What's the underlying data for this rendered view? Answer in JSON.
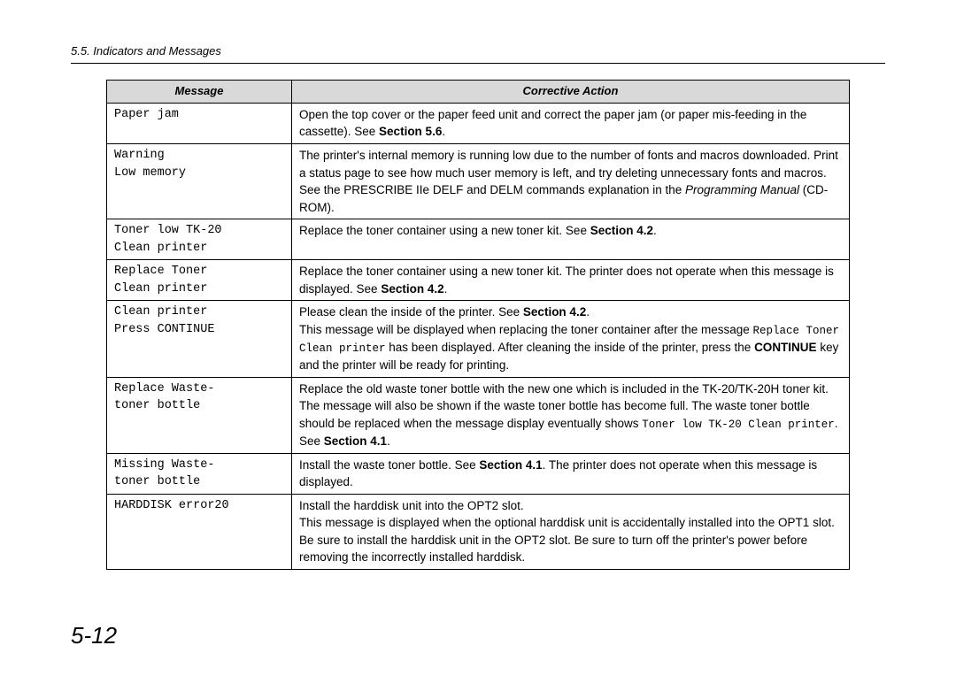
{
  "running_head": "5.5.  Indicators and Messages",
  "page_number": "5-12",
  "table": {
    "headers": {
      "col1": "Message",
      "col2": "Corrective Action"
    },
    "rows": [
      {
        "msg": "Paper jam",
        "action_pre": "Open the top cover or the paper feed unit and correct the paper jam (or paper mis-feeding in the cassette). See ",
        "action_bold": "Section 5.6",
        "action_post": "."
      },
      {
        "msg": "Warning\nLow memory",
        "action_pre": "The printer's internal memory is running low due to the number of fonts and macros downloaded. Print a status page to see how much user memory is left, and try deleting unnecessary fonts and macros. See the PRESCRIBE IIe DELF and DELM commands explanation in the ",
        "action_italic": "Programming Manual",
        "action_post": " (CD-ROM)."
      },
      {
        "msg": "Toner low TK-20\nClean printer",
        "action_pre": "Replace the toner container using a new toner kit. See ",
        "action_bold": "Section 4.2",
        "action_post": "."
      },
      {
        "msg": "Replace Toner\nClean printer",
        "action_pre": "Replace the toner container using a new toner kit. The printer does not operate when this message is displayed. See ",
        "action_bold": "Section 4.2",
        "action_post": "."
      },
      {
        "msg": "Clean printer\nPress CONTINUE",
        "a1": "Please clean the inside of the printer. See ",
        "a1_bold": "Section 4.2",
        "a1_post": ".",
        "a2_pre": "This message will be displayed when replacing the toner container after the message ",
        "a2_mono": "Replace Toner Clean printer",
        "a2_mid": " has been displayed. After cleaning the inside of the printer, press the ",
        "a2_bold": "CONTINUE",
        "a2_post": " key and the printer will be ready for printing."
      },
      {
        "msg": "Replace Waste-\ntoner bottle",
        "a_pre": "Replace the old waste toner bottle with the new one which is included in the TK-20/TK-20H toner kit. The message will also be shown if the waste toner bottle has become full. The waste toner bottle should be replaced when the message display eventually shows ",
        "a_mono": "Toner low TK-20 Clean printer",
        "a_mid": ". See ",
        "a_bold": "Section 4.1",
        "a_post": "."
      },
      {
        "msg": "Missing Waste-\ntoner bottle",
        "a_pre": "Install the waste toner bottle. See ",
        "a_bold": "Section 4.1",
        "a_post": ". The printer does not operate when this message is displayed."
      },
      {
        "msg": "HARDDISK error20",
        "a_line1": "Install the harddisk unit into the OPT2 slot.",
        "a_line2": "This message is displayed when the optional harddisk unit is accidentally installed into the OPT1 slot.  Be sure to install the harddisk unit in the OPT2 slot.  Be sure to turn off the printer's power before removing the incorrectly installed harddisk."
      }
    ]
  }
}
